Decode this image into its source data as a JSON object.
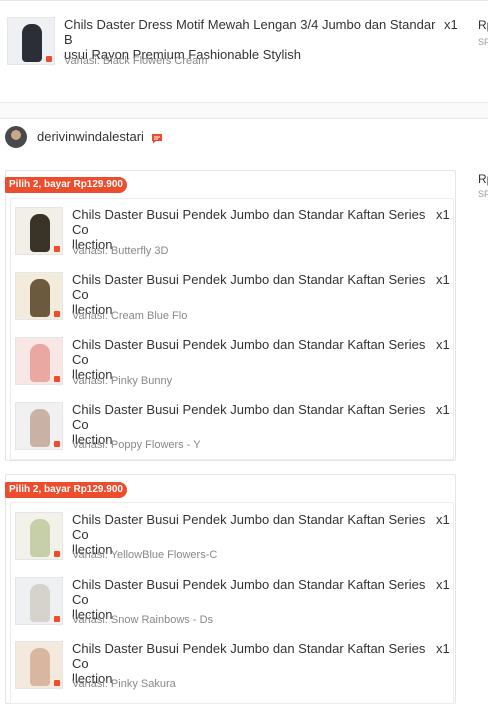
{
  "top_item": {
    "title_line1": "Chils Daster Dress Motif Mewah Lengan 3/4 Jumbo dan Standar B",
    "title_line2": "usui Rayon Premium Fashionable Stylish",
    "qty": "x1",
    "variant": "Variasi: Black Flowers Cream",
    "price_cut": "Rp",
    "sub_cut": "SP"
  },
  "shop": {
    "name": "derivinwindalestari",
    "price_cut": "Rp",
    "sub_cut": "SP"
  },
  "bundles": [
    {
      "promo": "Pilih 2, bayar Rp129.900",
      "items": [
        {
          "title_line1": "Chils Daster Busui Pendek Jumbo dan Standar Kaftan Series Co",
          "title_line2": "llection",
          "qty": "x1",
          "variant": "Variasi: Butterfly 3D"
        },
        {
          "title_line1": "Chils Daster Busui Pendek Jumbo dan Standar Kaftan Series Co",
          "title_line2": "llection",
          "qty": "x1",
          "variant": "Variasi: Cream Blue Flo"
        },
        {
          "title_line1": "Chils Daster Busui Pendek Jumbo dan Standar Kaftan Series Co",
          "title_line2": "llection",
          "qty": "x1",
          "variant": "Variasi: Pinky Bunny"
        },
        {
          "title_line1": "Chils Daster Busui Pendek Jumbo dan Standar Kaftan Series Co",
          "title_line2": "llection",
          "qty": "x1",
          "variant": "Variasi: Poppy Flowers - Y"
        }
      ]
    },
    {
      "promo": "Pilih 2, bayar Rp129.900",
      "items": [
        {
          "title_line1": "Chils Daster Busui Pendek Jumbo dan Standar Kaftan Series Co",
          "title_line2": "llection",
          "qty": "x1",
          "variant": "Variasi: YellowBlue Flowers-C"
        },
        {
          "title_line1": "Chils Daster Busui Pendek Jumbo dan Standar Kaftan Series Co",
          "title_line2": "llection",
          "qty": "x1",
          "variant": "Variasi: Snow Rainbows - Ds"
        },
        {
          "title_line1": "Chils Daster Busui Pendek Jumbo dan Standar Kaftan Series Co",
          "title_line2": "llection",
          "qty": "x1",
          "variant": "Variasi: Pinky Sakura"
        }
      ]
    }
  ],
  "colors": {
    "accent": "#ee4d2d",
    "border": "#e5e5e5",
    "variant_text": "#888888"
  },
  "icons": {
    "chat": "chat-icon"
  }
}
